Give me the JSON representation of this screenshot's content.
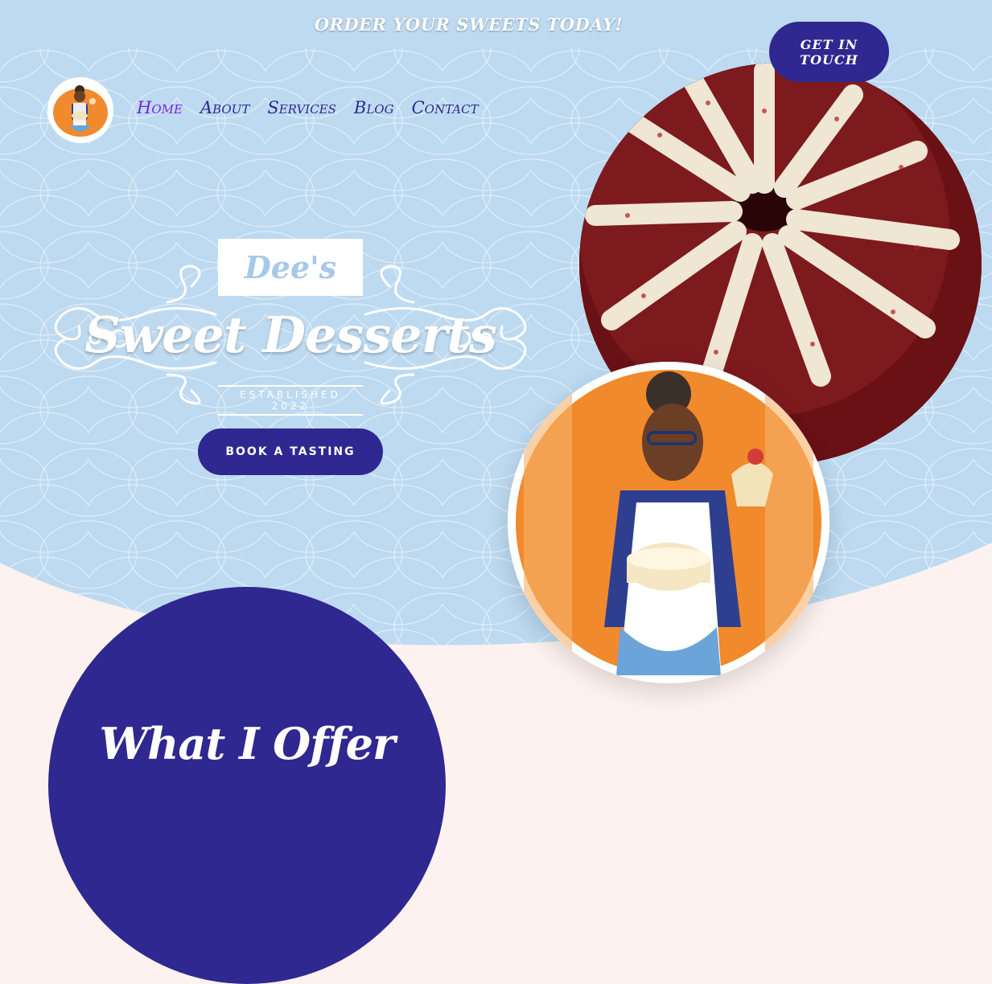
{
  "header": {
    "promo_text": "ORDER YOUR SWEETS TODAY!",
    "cta_label": "GET IN TOUCH"
  },
  "nav": {
    "items": [
      {
        "label": "Home",
        "active": true
      },
      {
        "label": "About",
        "active": false
      },
      {
        "label": "Services",
        "active": false
      },
      {
        "label": "Blog",
        "active": false
      },
      {
        "label": "Contact",
        "active": false
      }
    ]
  },
  "hero": {
    "brand_small": "Dee's",
    "brand_main": "Sweet Desserts",
    "established": "ESTABLISHED 2022",
    "book_label": "BOOK A TASTING"
  },
  "images": {
    "logo_icon": "baker-avatar-icon",
    "cake_image": "red-velvet-bundt-cake",
    "baker_image": "baker-illustration"
  },
  "section": {
    "title": "What I Offer"
  },
  "colors": {
    "hero_bg": "#bddaf1",
    "primary": "#2e2890",
    "active_nav": "#7b22d9",
    "page_bg": "#fdf2ef"
  }
}
